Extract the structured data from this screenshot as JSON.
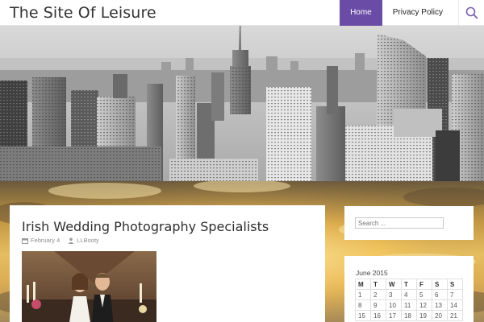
{
  "site": {
    "title": "The Site Of Leisure"
  },
  "nav": {
    "items": [
      {
        "label": "Home",
        "active": true
      },
      {
        "label": "Privacy Policy",
        "active": false
      }
    ]
  },
  "icons": {
    "search": "search-icon",
    "calendar": "calendar-icon",
    "author": "person-icon"
  },
  "colors": {
    "accent": "#6a4ba5",
    "header_bg": "#ffffff",
    "card_bg": "#ffffff"
  },
  "post": {
    "title": "Irish Wedding Photography Specialists",
    "date": "February 4",
    "author": "LLBooty"
  },
  "search": {
    "placeholder": "Search ..."
  },
  "calendar": {
    "caption": "June 2015",
    "days": [
      "M",
      "T",
      "W",
      "T",
      "F",
      "S",
      "S"
    ],
    "rows": [
      [
        "1",
        "2",
        "3",
        "4",
        "5",
        "6",
        "7"
      ],
      [
        "8",
        "9",
        "10",
        "11",
        "12",
        "13",
        "14"
      ],
      [
        "15",
        "16",
        "17",
        "18",
        "19",
        "20",
        "21"
      ]
    ]
  }
}
